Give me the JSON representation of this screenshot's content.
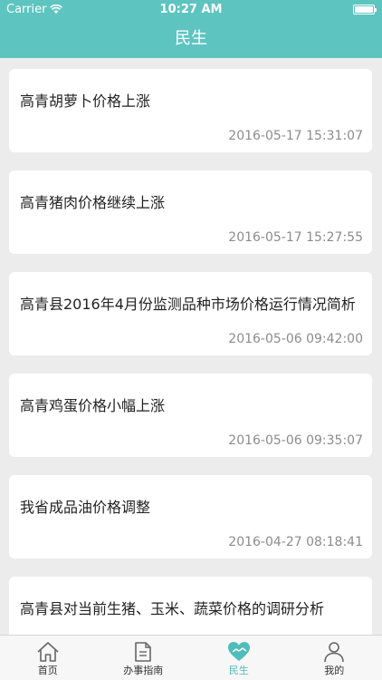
{
  "status_bar": {
    "carrier": "Carrier",
    "time": "10:27 AM"
  },
  "nav": {
    "title": "民生"
  },
  "items": [
    {
      "title": "高青胡萝卜价格上涨",
      "date": "2016-05-17 15:31:07"
    },
    {
      "title": "高青猪肉价格继续上涨",
      "date": "2016-05-17 15:27:55"
    },
    {
      "title": "高青县2016年4月份监测品种市场价格运行情况简析",
      "date": "2016-05-06 09:42:00"
    },
    {
      "title": "高青鸡蛋价格小幅上涨",
      "date": "2016-05-06 09:35:07"
    },
    {
      "title": "我省成品油价格调整",
      "date": "2016-04-27 08:18:41"
    },
    {
      "title": "高青县对当前生猪、玉米、蔬菜价格的调研分析",
      "date": ""
    }
  ],
  "tabs": [
    {
      "label": "首页"
    },
    {
      "label": "办事指南"
    },
    {
      "label": "民生"
    },
    {
      "label": "我的"
    }
  ],
  "colors": {
    "accent": "#5ec4c0",
    "active_tab": "#4fbdb9"
  }
}
